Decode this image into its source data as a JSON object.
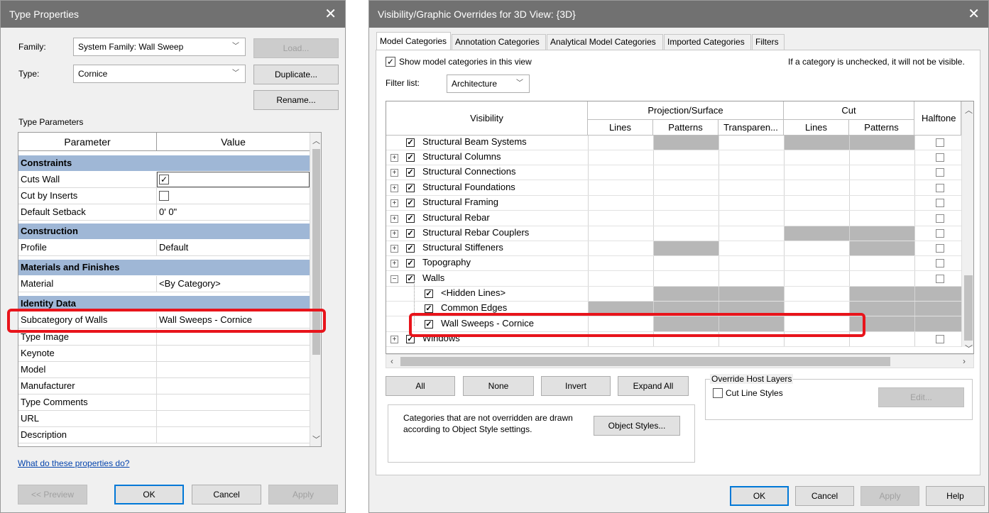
{
  "type_properties": {
    "title": "Type Properties",
    "family_label": "Family:",
    "family_value": "System Family: Wall Sweep",
    "type_label": "Type:",
    "type_value": "Cornice",
    "load_label": "Load...",
    "duplicate_label": "Duplicate...",
    "rename_label": "Rename...",
    "type_parameters_label": "Type Parameters",
    "col_parameter": "Parameter",
    "col_value": "Value",
    "col_eq": "=",
    "groups": {
      "constraints": "Constraints",
      "construction": "Construction",
      "materials": "Materials and Finishes",
      "identity": "Identity Data"
    },
    "rows": {
      "cuts_wall": "Cuts Wall",
      "cut_by_inserts": "Cut by Inserts",
      "default_setback": "Default Setback",
      "default_setback_value": "0'  0\"",
      "profile": "Profile",
      "profile_value": "Default",
      "material": "Material",
      "material_value": "<By Category>",
      "subcategory": "Subcategory of Walls",
      "subcategory_value": "Wall Sweeps - Cornice",
      "type_image": "Type Image",
      "keynote": "Keynote",
      "model": "Model",
      "manufacturer": "Manufacturer",
      "type_comments": "Type Comments",
      "url": "URL",
      "description": "Description"
    },
    "help_link": "What do these properties do?",
    "preview_label": "<< Preview",
    "ok_label": "OK",
    "cancel_label": "Cancel",
    "apply_label": "Apply"
  },
  "vg": {
    "title": "Visibility/Graphic Overrides for 3D View: {3D}",
    "tabs": [
      "Model Categories",
      "Annotation Categories",
      "Analytical Model Categories",
      "Imported Categories",
      "Filters"
    ],
    "show_label": "Show model categories in this view",
    "hint": "If a category is unchecked, it will not be visible.",
    "filter_label": "Filter list:",
    "filter_value": "Architecture",
    "head_visibility": "Visibility",
    "head_proj": "Projection/Surface",
    "head_cut": "Cut",
    "head_halftone": "Halftone",
    "head_lines": "Lines",
    "head_patterns": "Patterns",
    "head_transparency": "Transparen...",
    "head_cut_lines": "Lines",
    "head_cut_patterns": "Patterns",
    "rows": [
      "Structural Beam Systems",
      "Structural Columns",
      "Structural Connections",
      "Structural Foundations",
      "Structural Framing",
      "Structural Rebar",
      "Structural Rebar Couplers",
      "Structural Stiffeners",
      "Topography",
      "Walls",
      "<Hidden Lines>",
      "Common Edges",
      "Wall Sweeps - Cornice",
      "Windows"
    ],
    "btn_all": "All",
    "btn_none": "None",
    "btn_invert": "Invert",
    "btn_expand": "Expand All",
    "override_label": "Override Host Layers",
    "cut_line_styles": "Cut Line Styles",
    "edit_label": "Edit...",
    "note": "Categories that are not overridden are drawn according to Object Style settings.",
    "object_styles": "Object Styles...",
    "ok_label": "OK",
    "cancel_label": "Cancel",
    "apply_label": "Apply",
    "help_label": "Help"
  },
  "colors": {
    "highlight": "#e8141b",
    "group_header": "#9fb7d6",
    "titlebar": "#717171",
    "override_cell": "#b7b7b7"
  }
}
